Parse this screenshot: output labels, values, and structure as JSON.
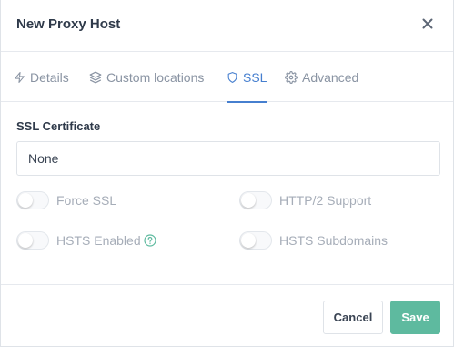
{
  "modal": {
    "title": "New Proxy Host"
  },
  "tabs": [
    {
      "label": "Details",
      "icon": "zap-icon"
    },
    {
      "label": "Custom locations",
      "icon": "layers-icon"
    },
    {
      "label": "SSL",
      "icon": "shield-icon",
      "active": true
    },
    {
      "label": "Advanced",
      "icon": "gear-icon"
    }
  ],
  "ssl": {
    "certificate_label": "SSL Certificate",
    "certificate_value": "None",
    "toggles": {
      "force_ssl": "Force SSL",
      "http2": "HTTP/2 Support",
      "hsts_enabled": "HSTS Enabled",
      "hsts_subdomains": "HSTS Subdomains"
    }
  },
  "footer": {
    "cancel_label": "Cancel",
    "save_label": "Save"
  },
  "colors": {
    "accent": "#467fcf",
    "save": "#5eba9f",
    "help": "#5eba9f"
  }
}
